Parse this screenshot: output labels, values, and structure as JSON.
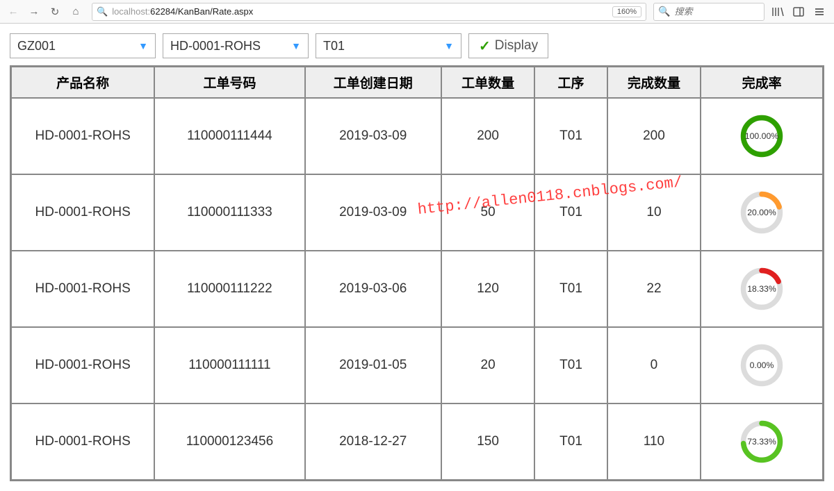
{
  "browser": {
    "url_host_dim": "localhost:",
    "url_rest": "62284/KanBan/Rate.aspx",
    "zoom": "160%",
    "search_placeholder": "搜索"
  },
  "controls": {
    "dd1": "GZ001",
    "dd2": "HD-0001-ROHS",
    "dd3": "T01",
    "display_label": "Display"
  },
  "table": {
    "headers": {
      "c1": "产品名称",
      "c2": "工单号码",
      "c3": "工单创建日期",
      "c4": "工单数量",
      "c5": "工序",
      "c6": "完成数量",
      "c7": "完成率"
    },
    "rows": [
      {
        "product": "HD-0001-ROHS",
        "order": "110000111444",
        "date": "2019-03-09",
        "qty": "200",
        "proc": "T01",
        "done": "200",
        "rate": 100.0,
        "rate_label": "100.00%",
        "color": "#2ea000"
      },
      {
        "product": "HD-0001-ROHS",
        "order": "110000111333",
        "date": "2019-03-09",
        "qty": "50",
        "proc": "T01",
        "done": "10",
        "rate": 20.0,
        "rate_label": "20.00%",
        "color": "#ff9a2e"
      },
      {
        "product": "HD-0001-ROHS",
        "order": "110000111222",
        "date": "2019-03-06",
        "qty": "120",
        "proc": "T01",
        "done": "22",
        "rate": 18.33,
        "rate_label": "18.33%",
        "color": "#e02020"
      },
      {
        "product": "HD-0001-ROHS",
        "order": "110000111111",
        "date": "2019-01-05",
        "qty": "20",
        "proc": "T01",
        "done": "0",
        "rate": 0.0,
        "rate_label": "0.00%",
        "color": "#dcdcdc"
      },
      {
        "product": "HD-0001-ROHS",
        "order": "110000123456",
        "date": "2018-12-27",
        "qty": "150",
        "proc": "T01",
        "done": "110",
        "rate": 73.33,
        "rate_label": "73.33%",
        "color": "#58c322"
      }
    ]
  },
  "watermark": "http://allen0118.cnblogs.com/",
  "chart_data": {
    "type": "table",
    "title": "KanBan Rate",
    "columns": [
      "产品名称",
      "工单号码",
      "工单创建日期",
      "工单数量",
      "工序",
      "完成数量",
      "完成率"
    ],
    "rows": [
      [
        "HD-0001-ROHS",
        "110000111444",
        "2019-03-09",
        200,
        "T01",
        200,
        100.0
      ],
      [
        "HD-0001-ROHS",
        "110000111333",
        "2019-03-09",
        50,
        "T01",
        10,
        20.0
      ],
      [
        "HD-0001-ROHS",
        "110000111222",
        "2019-03-06",
        120,
        "T01",
        22,
        18.33
      ],
      [
        "HD-0001-ROHS",
        "110000111111",
        "2019-01-05",
        20,
        "T01",
        0,
        0.0
      ],
      [
        "HD-0001-ROHS",
        "110000123456",
        "2018-12-27",
        150,
        "T01",
        110,
        73.33
      ]
    ]
  }
}
